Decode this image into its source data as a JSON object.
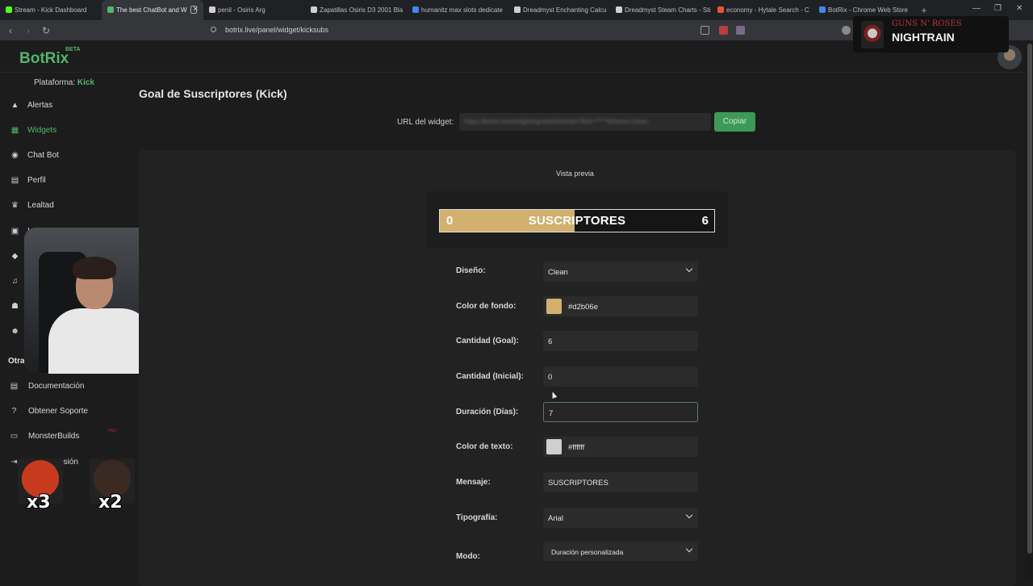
{
  "browser": {
    "tabs": [
      {
        "title": "Stream - Kick Dashboard",
        "fav": "#53fc18"
      },
      {
        "title": "The best ChatBot and W",
        "fav": "#53b56b",
        "active": true
      },
      {
        "title": "penil - Osiris Arg",
        "fav": "#cfcfcf"
      },
      {
        "title": "Zapatillas Osiris D3 2001 Bla",
        "fav": "#cfcfcf"
      },
      {
        "title": "humanitz max slots dedicate",
        "fav": "#4285f4"
      },
      {
        "title": "Dreadmyst Enchanting Calcu",
        "fav": "#cfcfcf"
      },
      {
        "title": "Dreadmyst Steam Charts - Sti",
        "fav": "#cfcfcf"
      },
      {
        "title": "economy - Hytale Search - C",
        "fav": "#e5533c"
      },
      {
        "title": "BotRix - Chrome Web Store",
        "fav": "#4285f4"
      }
    ],
    "url": "botrix.live/panel/widget/kicksubs"
  },
  "overlay": {
    "band": "GUNS N' ROSES",
    "song": "NIGHTRAIN"
  },
  "brand": {
    "name": "BotRix",
    "beta": "BETA"
  },
  "sidebar": {
    "platform_label": "Plataforma:",
    "platform_value": "Kick",
    "items": [
      {
        "label": "Alertas",
        "icon": "alert-triangle-icon",
        "glyph": "▲"
      },
      {
        "label": "Widgets",
        "icon": "grid-icon",
        "glyph": "▦",
        "active": true
      },
      {
        "label": "Chat Bot",
        "icon": "robot-icon",
        "glyph": "◉"
      },
      {
        "label": "Perfil",
        "icon": "id-card-icon",
        "glyph": "▤"
      },
      {
        "label": "Lealtad",
        "icon": "trophy-icon",
        "glyph": "♛"
      }
    ],
    "other_heading": "Otra",
    "other_items": [
      {
        "label": "Documentación",
        "icon": "book-icon",
        "glyph": "▤"
      },
      {
        "label": "Obtener Soporte",
        "icon": "question-icon",
        "glyph": "?"
      },
      {
        "label": "MonsterBuilds",
        "icon": "laptop-icon",
        "glyph": "▭"
      }
    ],
    "logout_partial": "esión",
    "new_badge": "FAQ"
  },
  "emotes": [
    {
      "count": "x3",
      "color": "#c83a1e"
    },
    {
      "count": "x2",
      "color": "#3b2a22"
    },
    {
      "count": "x2",
      "color": "#c9a58c"
    }
  ],
  "page": {
    "title": "Goal de Suscriptores (Kick)",
    "url_label": "URL del widget:",
    "url_value": "https://botrix.live/widgets/goals/kicksubs?bid=*****&theme=clean",
    "copy_label": "Copiar",
    "preview_label": "Vista previa"
  },
  "goal_preview": {
    "start": "0",
    "end": "6",
    "message": "SUSCRIPTORES",
    "progress": 0.49,
    "fill_color": "#d2b06e"
  },
  "form": {
    "design_label": "Diseño:",
    "design_value": "Clean",
    "bg_color_label": "Color de fondo:",
    "bg_color_value": "#d2b06e",
    "goal_label": "Cantidad (Goal):",
    "goal_value": "6",
    "initial_label": "Cantidad (Inicial):",
    "initial_value": "0",
    "duration_label": "Duración (Días):",
    "duration_value": "7",
    "text_color_label": "Color de texto:",
    "text_color_value": "#ffffff",
    "message_label": "Mensaje:",
    "message_value": "SUSCRIPTORES",
    "font_label": "Tipografía:",
    "font_value": "Arial",
    "mode_label": "Modo:",
    "mode_value": "Duración personalizada"
  }
}
